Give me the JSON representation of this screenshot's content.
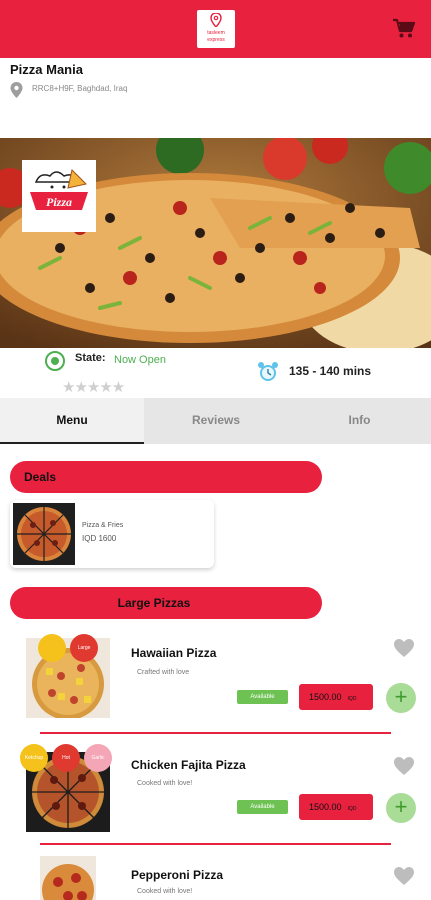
{
  "app": {
    "logo_line1": "tasleem",
    "logo_line2": "express",
    "accent": "#e8213f"
  },
  "restaurant": {
    "name": "Pizza Mania",
    "location": "RRC8+H9F, Baghdad, Iraq",
    "brand_text": "Pizza",
    "state_label": "State:",
    "state_value": "Now Open",
    "rating_stars": "★★★★★",
    "delivery_time": "135 - 140 mins"
  },
  "tabs": [
    {
      "label": "Menu",
      "active": true
    },
    {
      "label": "Reviews",
      "active": false
    },
    {
      "label": "Info",
      "active": false
    }
  ],
  "sections": {
    "deals": "Deals",
    "large_pizzas": "Large Pizzas"
  },
  "deal": {
    "title": "Pizza & Fries",
    "price": "IQD 1600"
  },
  "items": [
    {
      "name": "Hawaiian Pizza",
      "desc": "Crafted with love",
      "availability": "Available",
      "price": "1500.00",
      "currency": "IQD",
      "bubbles": [
        "",
        "Large"
      ]
    },
    {
      "name": "Chicken Fajita Pizza",
      "desc": "Cooked with love!",
      "availability": "Available",
      "price": "1500.00",
      "currency": "IQD",
      "bubbles": [
        "Ketchup",
        "Hot",
        "Garlic"
      ]
    },
    {
      "name": "Pepperoni Pizza",
      "desc": "Cooked with love!"
    }
  ]
}
